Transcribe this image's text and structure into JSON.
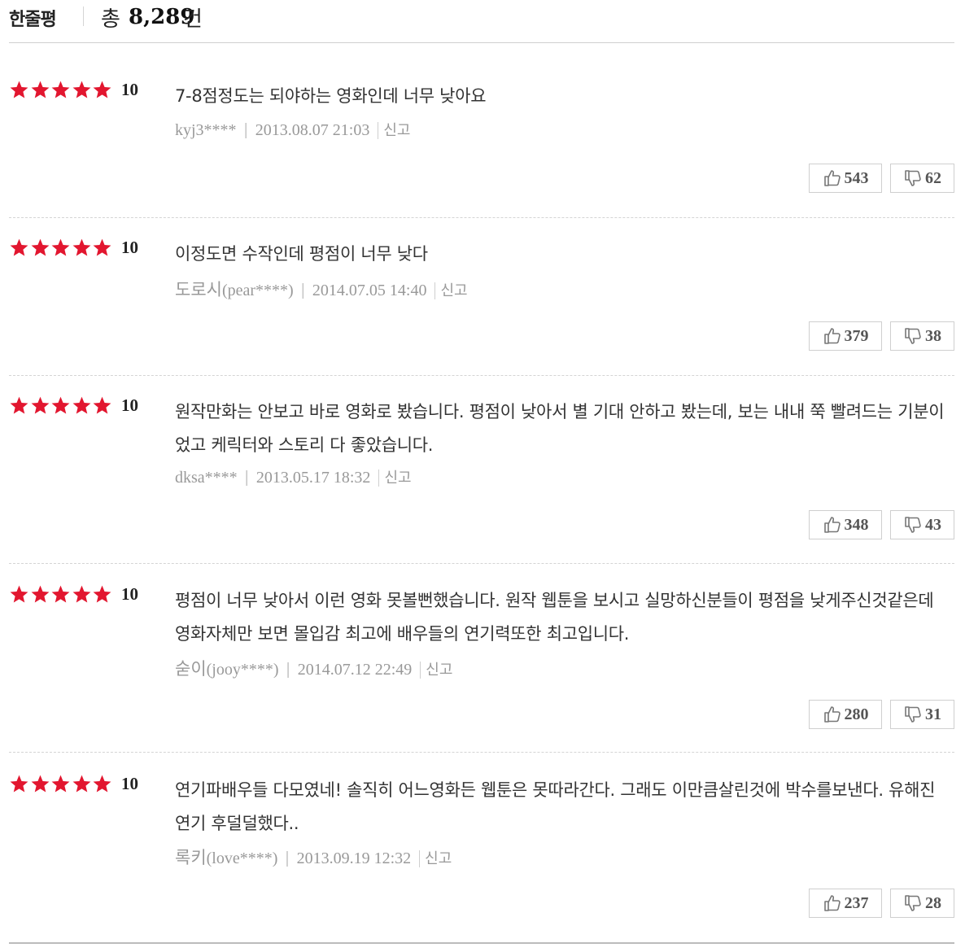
{
  "header": {
    "title": "한줄평",
    "total_label": "총",
    "total_count": "8,289",
    "total_unit": "건"
  },
  "star_color": "#e2162f",
  "reviews": [
    {
      "score": "10",
      "text": "7-8점정도는 되야하는 영화인데 너무 낮아요",
      "user_ko": "",
      "user_id": "kyj3****",
      "date": "2013.08.07 21:03",
      "report": "신고",
      "likes": "543",
      "dislikes": "62"
    },
    {
      "score": "10",
      "text": "이정도면 수작인데 평점이 너무 낮다",
      "user_ko": "도로시",
      "user_id": "(pear****)",
      "date": "2014.07.05 14:40",
      "report": "신고",
      "likes": "379",
      "dislikes": "38"
    },
    {
      "score": "10",
      "text": "원작만화는 안보고 바로 영화로 봤습니다. 평점이 낮아서 별 기대 안하고 봤는데, 보는 내내 쭉 빨려드는 기분이었고 케릭터와 스토리 다 좋았습니다.",
      "user_ko": "",
      "user_id": "dksa****",
      "date": "2013.05.17 18:32",
      "report": "신고",
      "likes": "348",
      "dislikes": "43"
    },
    {
      "score": "10",
      "text": "평점이 너무 낮아서 이런 영화 못볼뻔했습니다. 원작 웹툰을 보시고 실망하신분들이 평점을 낮게주신것같은데 영화자체만 보면 몰입감 최고에 배우들의 연기력또한 최고입니다.",
      "user_ko": "숟이",
      "user_id": "(jooy****)",
      "date": "2014.07.12 22:49",
      "report": "신고",
      "likes": "280",
      "dislikes": "31"
    },
    {
      "score": "10",
      "text": "연기파배우들 다모였네! 솔직히 어느영화든 웹툰은 못따라간다. 그래도 이만큼살린것에 박수를보낸다. 유해진연기 후덜덜했다..",
      "user_ko": "록키",
      "user_id": "(love****)",
      "date": "2013.09.19 12:32",
      "report": "신고",
      "likes": "237",
      "dislikes": "28"
    }
  ]
}
